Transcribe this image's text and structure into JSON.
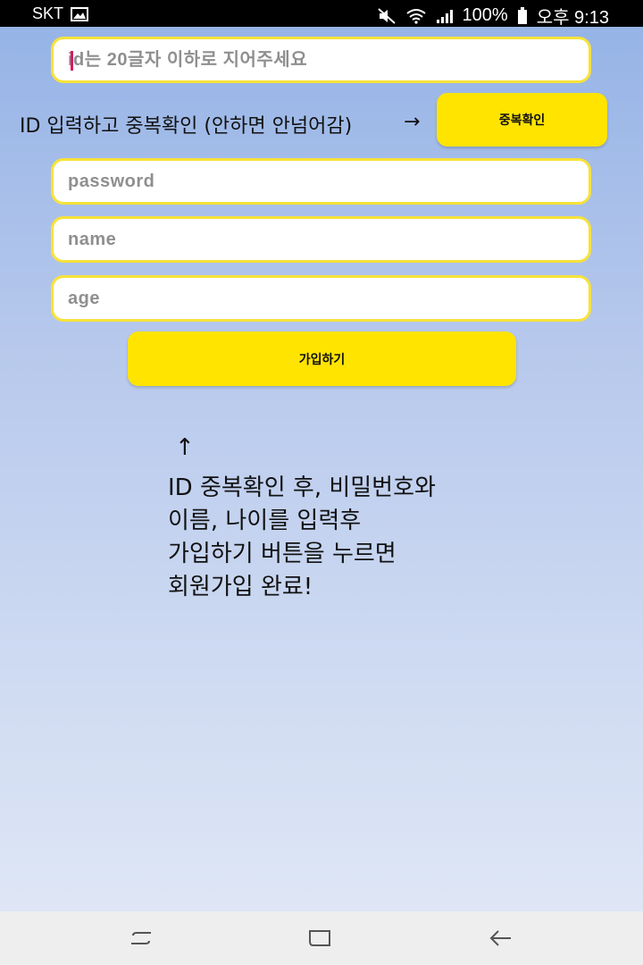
{
  "status_bar": {
    "carrier": "SKT",
    "battery": "100%",
    "time": "오후 9:13"
  },
  "form": {
    "id_placeholder": "id는 20글자 이하로 지어주세요",
    "dup_instruction": "ID 입력하고 중복확인 (안하면 안넘어감)",
    "dup_arrow": "→",
    "dup_button_label": "중복확인",
    "password_placeholder": "password",
    "name_placeholder": "name",
    "age_placeholder": "age",
    "signup_button_label": "가입하기"
  },
  "note": {
    "arrow": "↑",
    "lines": [
      "ID 중복확인 후, 비밀번호와",
      "이름, 나이를 입력후",
      "가입하기 버튼을 누르면",
      "회원가입 완료!"
    ]
  },
  "colors": {
    "accent_yellow": "#ffe400",
    "field_border": "#f7e23a",
    "caret": "#d81b60"
  },
  "icons": [
    "image-icon",
    "mute-icon",
    "wifi-icon",
    "signal-icon",
    "battery-icon",
    "recent-apps-icon",
    "home-icon",
    "back-icon"
  ]
}
